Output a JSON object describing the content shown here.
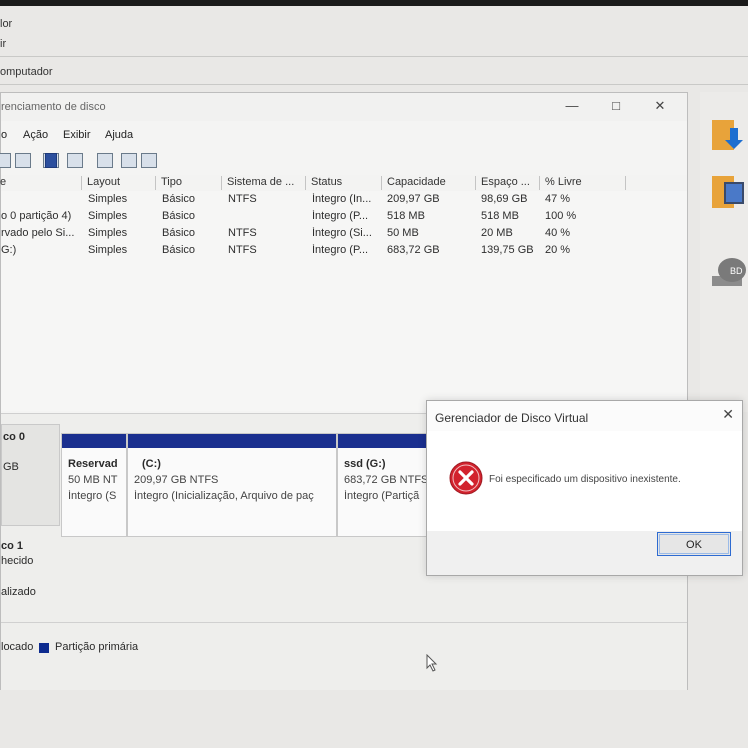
{
  "background": {
    "line1": "lor",
    "line2": "ir",
    "line3": "omputador"
  },
  "window": {
    "title": "renciamento de disco",
    "controls": {
      "minimize": "—",
      "maximize": "□",
      "close": "✕"
    },
    "menu": [
      "o",
      "Ação",
      "Exibir",
      "Ajuda"
    ],
    "columns": [
      "e",
      "Layout",
      "Tipo",
      "Sistema de ...",
      "Status",
      "Capacidade",
      "Espaço ...",
      "% Livre"
    ],
    "rows": [
      [
        "",
        "Simples",
        "Básico",
        "NTFS",
        "Íntegro (In...",
        "209,97 GB",
        "98,69 GB",
        "47 %"
      ],
      [
        "o 0 partição 4)",
        "Simples",
        "Básico",
        "",
        "Íntegro (P...",
        "518 MB",
        "518 MB",
        "100 %"
      ],
      [
        "rvado pelo Si...",
        "Simples",
        "Básico",
        "NTFS",
        "Íntegro (Si...",
        "50 MB",
        "20 MB",
        "40 %"
      ],
      [
        "G:)",
        "Simples",
        "Básico",
        "NTFS",
        "Íntegro (P...",
        "683,72 GB",
        "139,75 GB",
        "20 %"
      ]
    ]
  },
  "disks": {
    "disk0": {
      "name": "co 0",
      "size": "GB"
    },
    "partitions": [
      {
        "name": "Reservad",
        "size": "50 MB NT",
        "status": "Íntegro (S"
      },
      {
        "name": "(C:)",
        "size": "209,97 GB NTFS",
        "status": "Íntegro (Inicialização, Arquivo de paç"
      },
      {
        "name": "ssd  (G:)",
        "size": "683,72 GB NTFS",
        "status": "Íntegro (Partiçã"
      }
    ],
    "disk1": {
      "name": "co 1",
      "line2": "hecido",
      "line3": "alizado"
    }
  },
  "legend": {
    "unallocated": "locado",
    "primary": "Partição primária",
    "primary_color": "#0d2b8f"
  },
  "dialog": {
    "title": "Gerenciador de Disco Virtual",
    "close": "✕",
    "message": "Foi especificado um dispositivo inexistente.",
    "ok": "OK",
    "icon": "error-icon"
  }
}
